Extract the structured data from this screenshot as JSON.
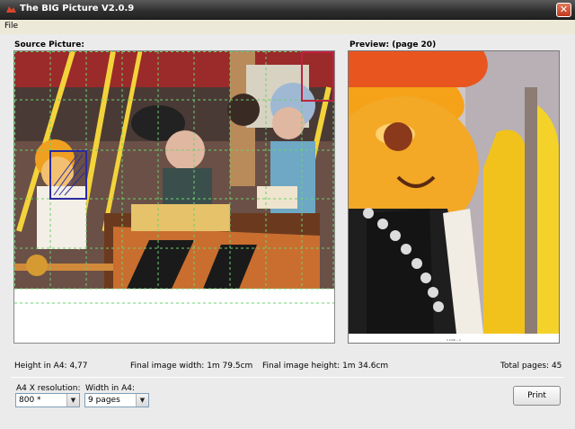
{
  "window": {
    "title": "The BIG Picture V2.0.9",
    "close_symbol": "✕"
  },
  "menu": {
    "file": "File"
  },
  "source": {
    "label": "Source Picture:"
  },
  "preview": {
    "label": "Preview: (page  20)",
    "footer_text": "1 1/20 ~ 1"
  },
  "info": {
    "height_a4": "Height in A4: 4,77",
    "final_width": "Final image width:  1m  79.5cm",
    "final_height": "Final image height:  1m  34.6cm",
    "total_pages": "Total pages: 45"
  },
  "controls": {
    "xres_label": "A4 X resolution:",
    "xres_value": "800 *",
    "width_label": "Width in A4:",
    "width_value": "9 pages",
    "print_label": "Print"
  },
  "colors": {
    "grid_line": "#6fd06f",
    "selected_page": "#2a2aa0",
    "current_page": "#c02040"
  }
}
